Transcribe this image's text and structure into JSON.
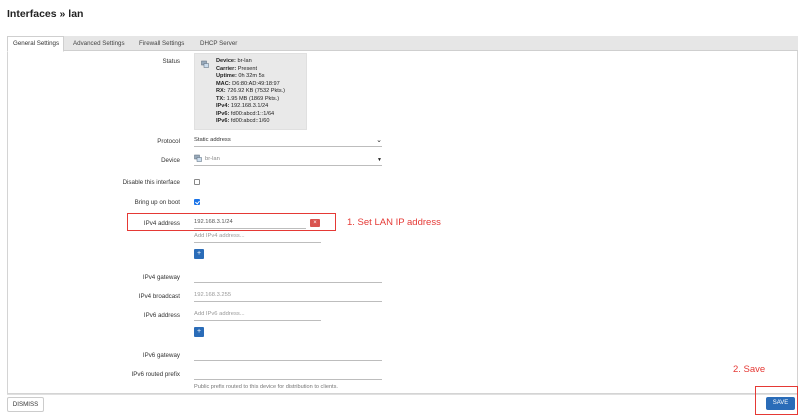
{
  "page": {
    "title": "Interfaces » lan"
  },
  "tabs": [
    {
      "label": "General Settings"
    },
    {
      "label": "Advanced Settings"
    },
    {
      "label": "Firewall Settings"
    },
    {
      "label": "DHCP Server"
    }
  ],
  "status": {
    "label": "Status",
    "lines": [
      {
        "key": "Device:",
        "value": " br-lan",
        "bold": true
      },
      {
        "key": "Carrier:",
        "value": " Present",
        "bold": true
      },
      {
        "key": "Uptime:",
        "value": " 0h 32m 5s",
        "bold": true
      },
      {
        "key": "MAC:",
        "value": " D6:80:AD:49:18:97",
        "bold": true
      },
      {
        "key": "RX:",
        "value": " 726.92 KB (7532 Pkts.)",
        "bold": true
      },
      {
        "key": "TX:",
        "value": " 1.95 MB (1869 Pkts.)",
        "bold": true
      },
      {
        "key": "IPv4:",
        "value": " 192.168.3.1/24",
        "bold": true
      },
      {
        "key": "IPv6:",
        "value": " fd00:abcd:1::1/64",
        "bold": true
      },
      {
        "key": "IPv6:",
        "value": " fd00:abcd::1/60",
        "bold": true
      }
    ]
  },
  "fields": {
    "protocol": {
      "label": "Protocol",
      "value": "Static address"
    },
    "device": {
      "label": "Device",
      "value": "br-lan"
    },
    "disable_interface": {
      "label": "Disable this interface",
      "checked": false
    },
    "bring_up": {
      "label": "Bring up on boot",
      "checked": true
    },
    "ipv4_address": {
      "label": "IPv4 address",
      "value": "192.168.3.1/24",
      "add_placeholder": "Add IPv4 address..."
    },
    "ipv4_gateway": {
      "label": "IPv4 gateway",
      "value": ""
    },
    "ipv4_broadcast": {
      "label": "IPv4 broadcast",
      "placeholder": "192.168.3.255"
    },
    "ipv6_address": {
      "label": "IPv6 address",
      "add_placeholder": "Add IPv6 address..."
    },
    "ipv6_gateway": {
      "label": "IPv6 gateway",
      "value": ""
    },
    "ipv6_routed_prefix": {
      "label": "IPv6 routed prefix",
      "value": "",
      "hint": "Public prefix routed to this device for distribution to clients."
    }
  },
  "buttons": {
    "delete": "×",
    "add": "+",
    "dismiss": "DISMISS",
    "save": "SAVE"
  },
  "annotations": {
    "step1": "1.  Set LAN IP address",
    "step2": "2. Save"
  },
  "colors": {
    "annotation": "#e53935",
    "primary": "#2a6cb8",
    "danger": "#d9534f"
  }
}
